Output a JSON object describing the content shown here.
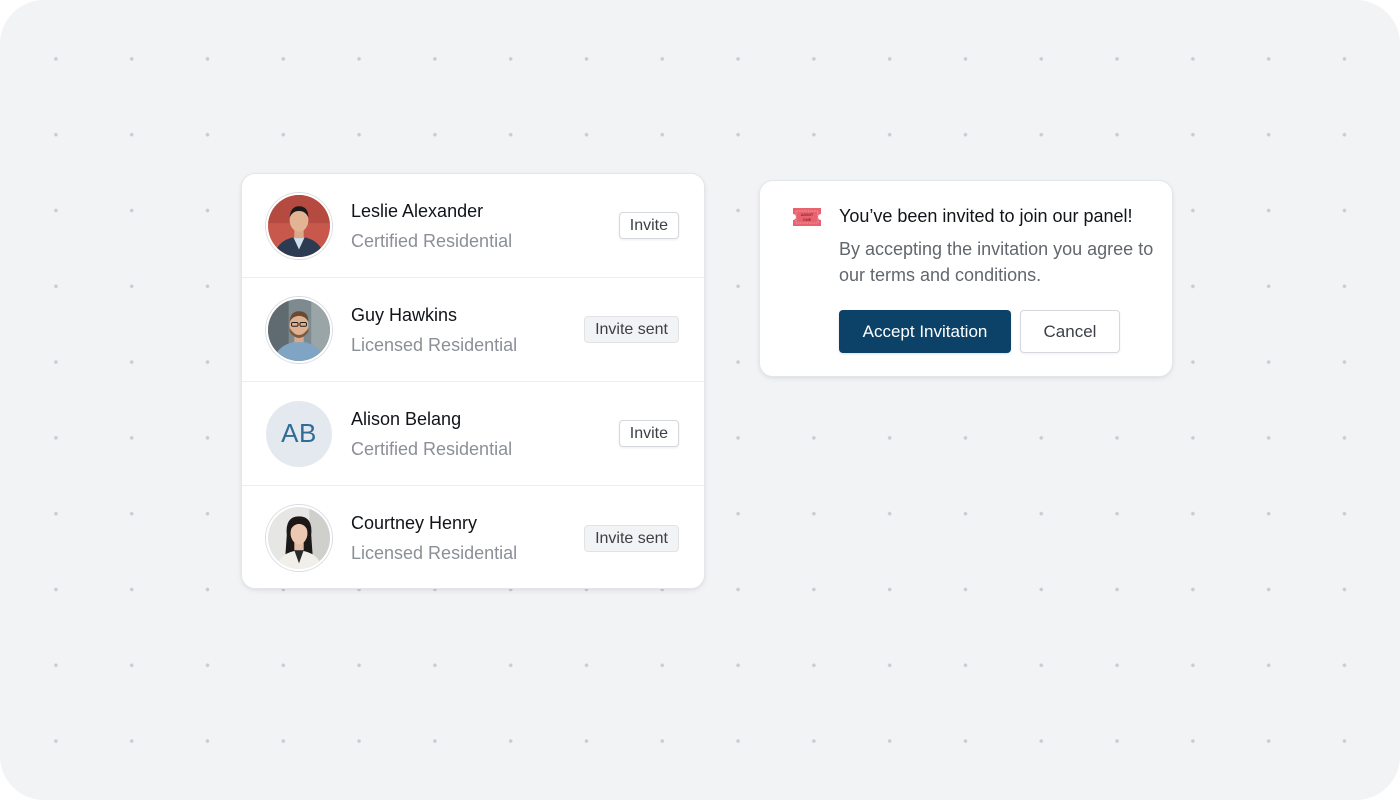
{
  "people": [
    {
      "name": "Leslie Alexander",
      "role": "Certified Residential",
      "action": "Invite",
      "action_state": "default",
      "avatar": "photo"
    },
    {
      "name": "Guy Hawkins",
      "role": "Licensed Residential",
      "action": "Invite sent",
      "action_state": "sent",
      "avatar": "photo"
    },
    {
      "name": "Alison Belang",
      "role": "Certified Residential",
      "action": "Invite",
      "action_state": "default",
      "avatar": "initials",
      "initials": "AB"
    },
    {
      "name": "Courtney Henry",
      "role": "Licensed Residential",
      "action": "Invite sent",
      "action_state": "sent",
      "avatar": "photo"
    }
  ],
  "invitation": {
    "icon": "ticket-icon",
    "ticket_text_line1": "ADMIT",
    "ticket_text_line2": "ONE",
    "title": "You’ve been invited to join our panel!",
    "body": "By accepting the invitation you agree to our terms and conditions.",
    "accept_label": "Accept Invitation",
    "cancel_label": "Cancel"
  },
  "colors": {
    "primary": "#0d4268",
    "initials_text": "#2f6d96",
    "initials_bg": "#e4e9ef",
    "ticket": "#e8636f"
  }
}
